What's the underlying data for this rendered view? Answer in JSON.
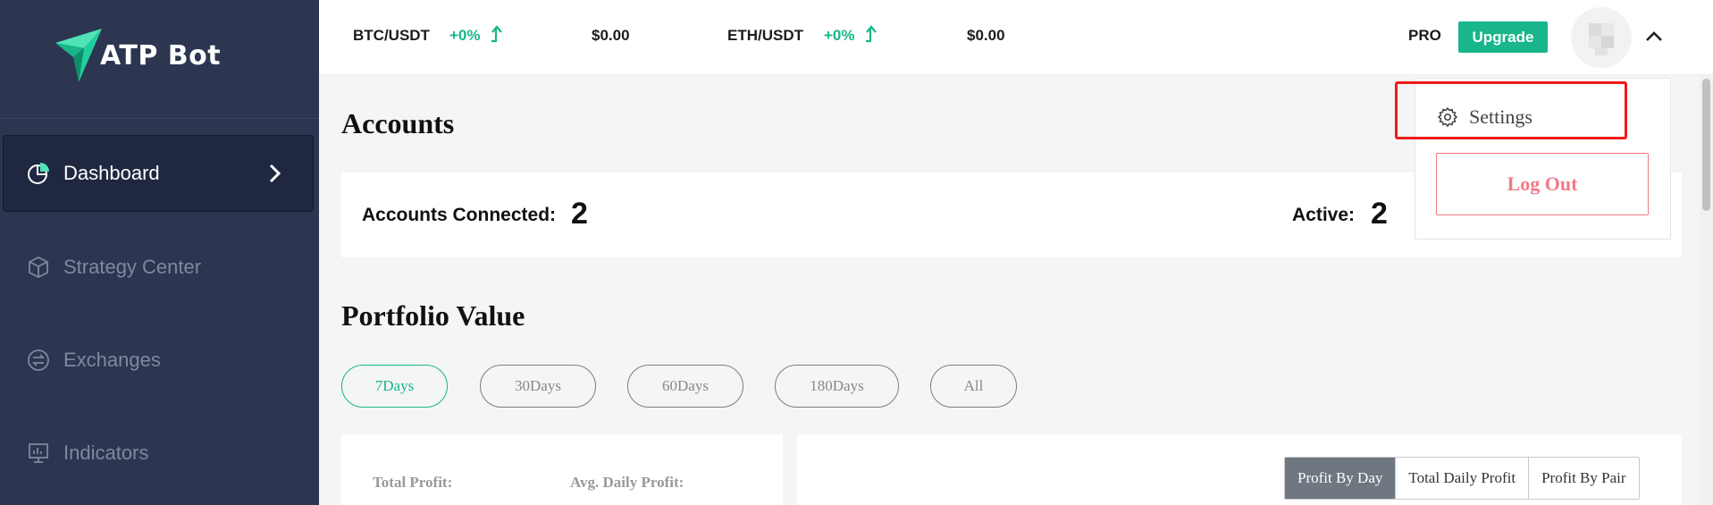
{
  "app": {
    "brand": "ATP Bot",
    "colors": {
      "accent": "#18b68a",
      "sidebar": "#2c3651",
      "danger": "#f07a87",
      "highlight": "#ef1b1b"
    }
  },
  "sidebar": {
    "items": [
      {
        "label": "Dashboard",
        "icon": "pie-chart-icon",
        "active": true
      },
      {
        "label": "Strategy Center",
        "icon": "cube-icon",
        "active": false
      },
      {
        "label": "Exchanges",
        "icon": "exchange-icon",
        "active": false
      },
      {
        "label": "Indicators",
        "icon": "monitor-chart-icon",
        "active": false
      }
    ]
  },
  "topbar": {
    "tickers": [
      {
        "symbol": "BTC/USDT",
        "change": "+0%",
        "price": "$0.00"
      },
      {
        "symbol": "ETH/USDT",
        "change": "+0%",
        "price": "$0.00"
      }
    ],
    "plan": "PRO",
    "upgrade_label": "Upgrade"
  },
  "user_menu": {
    "settings_label": "Settings",
    "logout_label": "Log Out"
  },
  "accounts": {
    "title": "Accounts",
    "connected_label": "Accounts Connected:",
    "connected_value": "2",
    "active_label": "Active:",
    "active_value": "2"
  },
  "portfolio": {
    "title": "Portfolio Value",
    "ranges": [
      "7Days",
      "30Days",
      "60Days",
      "180Days",
      "All"
    ],
    "selected_range": "7Days",
    "total_profit_label": "Total Profit:",
    "avg_daily_profit_label": "Avg. Daily Profit:",
    "views": [
      "Profit By Day",
      "Total Daily Profit",
      "Profit By Pair"
    ],
    "selected_view": "Profit By Day"
  }
}
